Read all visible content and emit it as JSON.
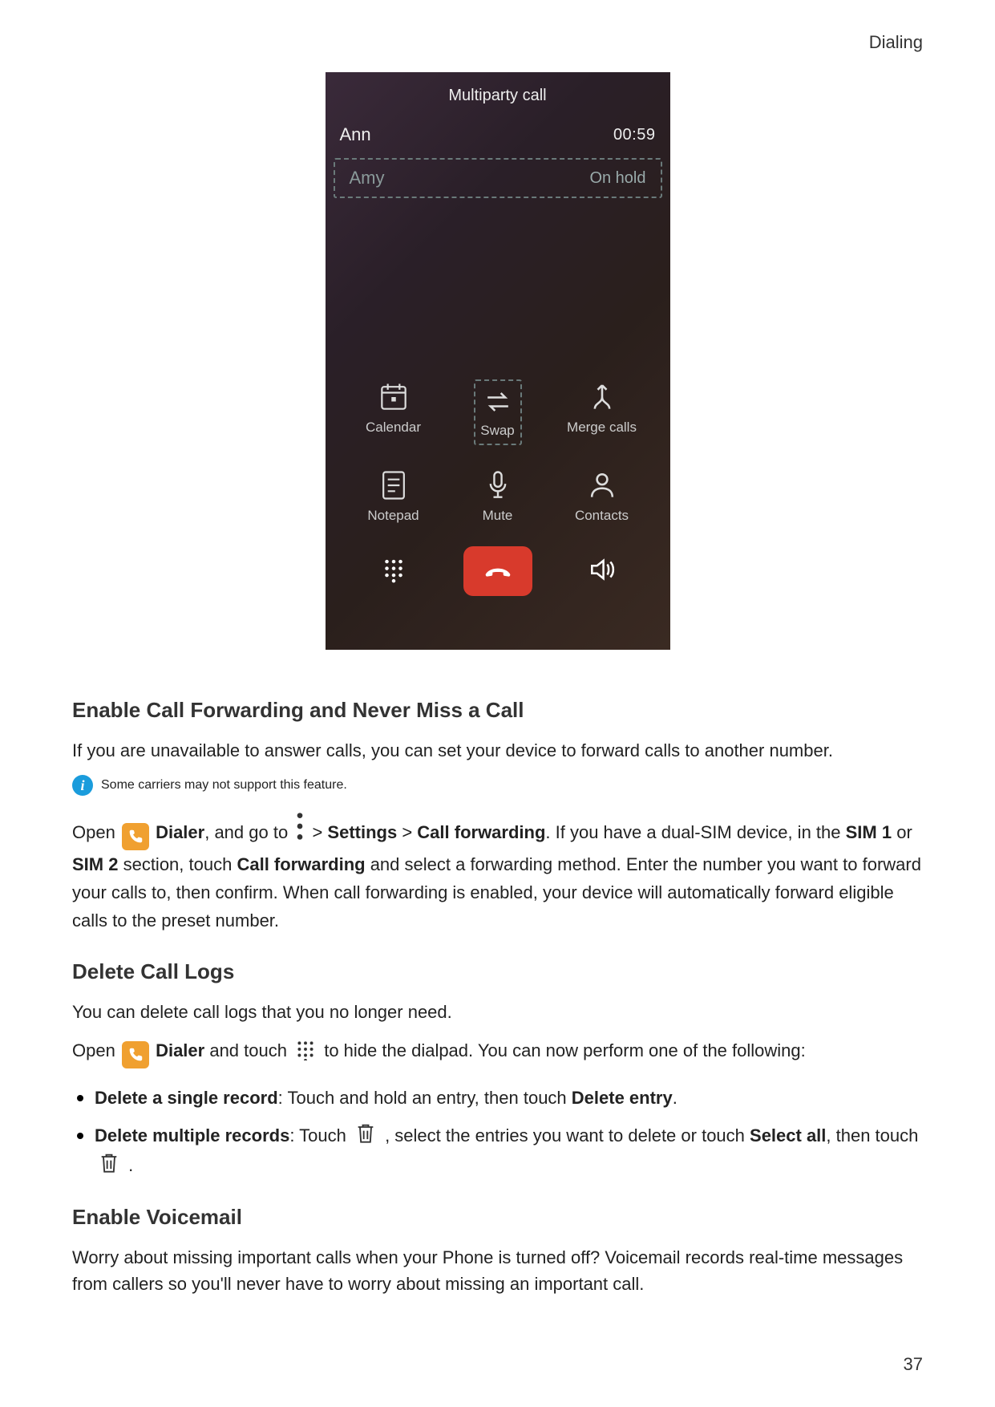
{
  "header": {
    "section": "Dialing"
  },
  "page_number": "37",
  "phone": {
    "title": "Multiparty call",
    "calls": [
      {
        "name": "Ann",
        "meta": "00:59"
      },
      {
        "name": "Amy",
        "meta": "On hold"
      }
    ],
    "grid": {
      "calendar": "Calendar",
      "swap": "Swap",
      "merge": "Merge calls",
      "notepad": "Notepad",
      "mute": "Mute",
      "contacts": "Contacts"
    }
  },
  "sections": {
    "s1": {
      "title": "Enable Call Forwarding and Never Miss a Call",
      "p1": "If you are unavailable to answer calls, you can set your device to forward calls to another number.",
      "note": "Some carriers may not support this feature.",
      "para_open": "Open ",
      "dialer": "Dialer",
      "para_a": ", and go to ",
      "gt1": " > ",
      "settings": "Settings",
      "gt2": " > ",
      "cfwd": "Call forwarding",
      "para_b": ". If you have a dual-SIM device, in the ",
      "sim1": "SIM 1",
      "or": " or ",
      "sim2": "SIM 2",
      "para_c": " section, touch ",
      "cfwd2": "Call forwarding",
      "para_d": " and select a forwarding method. Enter the number you want to forward your calls to, then confirm. When call forwarding is enabled, your device will automatically forward eligible calls to the preset number."
    },
    "s2": {
      "title": "Delete Call Logs",
      "p1": "You can delete call logs that you no longer need.",
      "para_open": "Open ",
      "dialer": "Dialer",
      "para_a": " and touch ",
      "para_b": " to hide the dialpad. You can now perform one of the following:",
      "b1a": "Delete a single record",
      "b1b": ": Touch and hold an entry, then touch ",
      "b1c": "Delete entry",
      "b1d": ".",
      "b2a": "Delete multiple records",
      "b2b": ": Touch ",
      "b2c": " , select the entries you want to delete or touch ",
      "b2d": "Select all",
      "b2e": ", then touch ",
      "b2f": " ."
    },
    "s3": {
      "title": "Enable Voicemail",
      "p1": "Worry about missing important calls when your Phone is turned off? Voicemail records real-time messages from callers so you'll never have to worry about missing an important call."
    }
  }
}
